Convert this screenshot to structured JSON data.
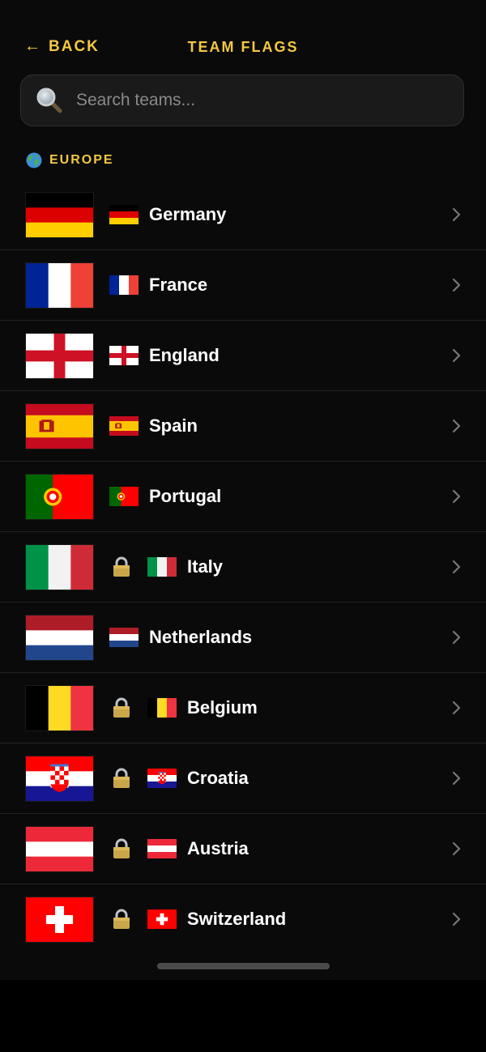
{
  "header": {
    "back_label": "BACK",
    "back_arrow": "←",
    "title": "TEAM FLAGS"
  },
  "search": {
    "placeholder": "Search teams...",
    "value": "",
    "icon": "magnifying-glass-icon"
  },
  "section": {
    "label": "EUROPE",
    "icon": "globe-icon"
  },
  "teams": [
    {
      "name": "Germany",
      "flag": "germany",
      "locked": false
    },
    {
      "name": "France",
      "flag": "france",
      "locked": false
    },
    {
      "name": "England",
      "flag": "england",
      "locked": false
    },
    {
      "name": "Spain",
      "flag": "spain",
      "locked": false
    },
    {
      "name": "Portugal",
      "flag": "portugal",
      "locked": false
    },
    {
      "name": "Italy",
      "flag": "italy",
      "locked": true
    },
    {
      "name": "Netherlands",
      "flag": "netherlands",
      "locked": false
    },
    {
      "name": "Belgium",
      "flag": "belgium",
      "locked": true
    },
    {
      "name": "Croatia",
      "flag": "croatia",
      "locked": true
    },
    {
      "name": "Austria",
      "flag": "austria",
      "locked": true
    },
    {
      "name": "Switzerland",
      "flag": "switzerland",
      "locked": true
    }
  ],
  "colors": {
    "accent": "#f5c842",
    "background": "#0a0a0a",
    "divider": "#222222"
  }
}
